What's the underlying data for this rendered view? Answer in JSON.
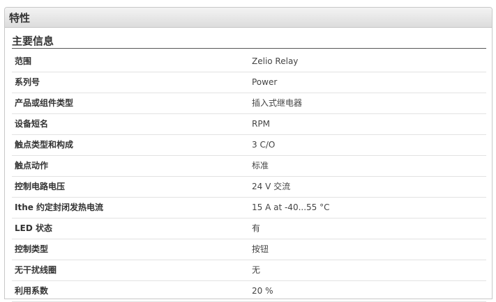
{
  "panel": {
    "title": "特性"
  },
  "section": {
    "title": "主要信息",
    "rows": [
      {
        "label": "范围",
        "value": "Zelio Relay"
      },
      {
        "label": "系列号",
        "value": "Power"
      },
      {
        "label": "产品或组件类型",
        "value": "插入式继电器"
      },
      {
        "label": "设备短名",
        "value": "RPM"
      },
      {
        "label": "触点类型和构成",
        "value": "3 C/O"
      },
      {
        "label": "触点动作",
        "value": "标准"
      },
      {
        "label": "控制电路电压",
        "value": "24 V 交流"
      },
      {
        "label": "Ithe 约定封闭发热电流",
        "value": "15 A at -40...55 °C"
      },
      {
        "label": "LED 状态",
        "value": "有"
      },
      {
        "label": "控制类型",
        "value": "按钮"
      },
      {
        "label": "无干扰线圈",
        "value": "无"
      },
      {
        "label": "利用系数",
        "value": "20 %"
      }
    ]
  }
}
